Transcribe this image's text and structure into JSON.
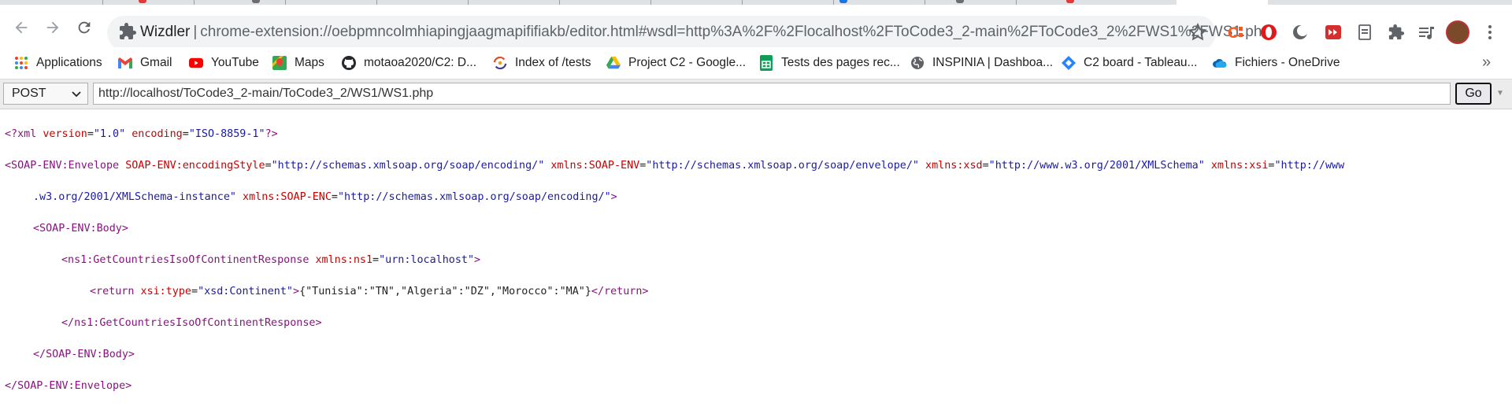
{
  "browser": {
    "omnibox": {
      "site_name": "Wizdler",
      "separator": "|",
      "url": "chrome-extension://oebpmncolmhiapingjaagmapififiakb/editor.html#wsdl=http%3A%2F%2Flocalhost%2FToCode3_2-main%2FToCode3_2%2FWS1%2FWS1.ph..."
    },
    "bookmarks": [
      {
        "label": "Applications",
        "icon": "apps-grid-icon"
      },
      {
        "label": "Gmail",
        "icon": "gmail-icon"
      },
      {
        "label": "YouTube",
        "icon": "youtube-icon"
      },
      {
        "label": "Maps",
        "icon": "maps-icon"
      },
      {
        "label": "motaoa2020/C2: D...",
        "icon": "github-icon"
      },
      {
        "label": "Index of /tests",
        "icon": "localhost-icon"
      },
      {
        "label": "Project C2 - Google...",
        "icon": "google-drive-icon"
      },
      {
        "label": "Tests des pages rec...",
        "icon": "google-sheets-icon"
      },
      {
        "label": "INSPINIA | Dashboa...",
        "icon": "globe-icon"
      },
      {
        "label": "C2 board - Tableau...",
        "icon": "jira-icon"
      },
      {
        "label": "Fichiers - OneDrive",
        "icon": "onedrive-icon"
      }
    ],
    "bookmarks_more": "»"
  },
  "request": {
    "method": "POST",
    "url": "http://localhost/ToCode3_2-main/ToCode3_2/WS1/WS1.php",
    "go_label": "Go"
  },
  "xml": {
    "decl": {
      "open": "<?xml",
      "version_attr": "version",
      "version_val": "\"1.0\"",
      "encoding_attr": "encoding",
      "encoding_val": "\"ISO-8859-1\"",
      "close": "?>"
    },
    "envelope": {
      "open": "<SOAP-ENV:Envelope",
      "a1": "SOAP-ENV:encodingStyle",
      "v1": "\"http://schemas.xmlsoap.org/soap/encoding/\"",
      "a2": "xmlns:SOAP-ENV",
      "v2": "\"http://schemas.xmlsoap.org/soap/envelope/\"",
      "a3": "xmlns:xsd",
      "v3": "\"http://www.w3.org/2001/XMLSchema\"",
      "a4": "xmlns:xsi",
      "v4a": "\"http://www",
      "v4b": ".w3.org/2001/XMLSchema-instance\"",
      "a5": "xmlns:SOAP-ENC",
      "v5": "\"http://schemas.xmlsoap.org/soap/encoding/\"",
      "gt": ">",
      "close": "</SOAP-ENV:Envelope>"
    },
    "body": {
      "open": "<SOAP-ENV:Body>",
      "close": "</SOAP-ENV:Body>"
    },
    "response": {
      "open": "<ns1:GetCountriesIsoOfContinentResponse",
      "attr": "xmlns:ns1",
      "val": "\"urn:localhost\"",
      "gt": ">",
      "close": "</ns1:GetCountriesIsoOfContinentResponse>"
    },
    "return": {
      "open": "<return",
      "attr": "xsi:type",
      "val": "\"xsd:Continent\"",
      "gt": ">",
      "content": "{\"Tunisia\":\"TN\",\"Algeria\":\"DZ\",\"Morocco\":\"MA\"}",
      "close": "</return>"
    }
  }
}
